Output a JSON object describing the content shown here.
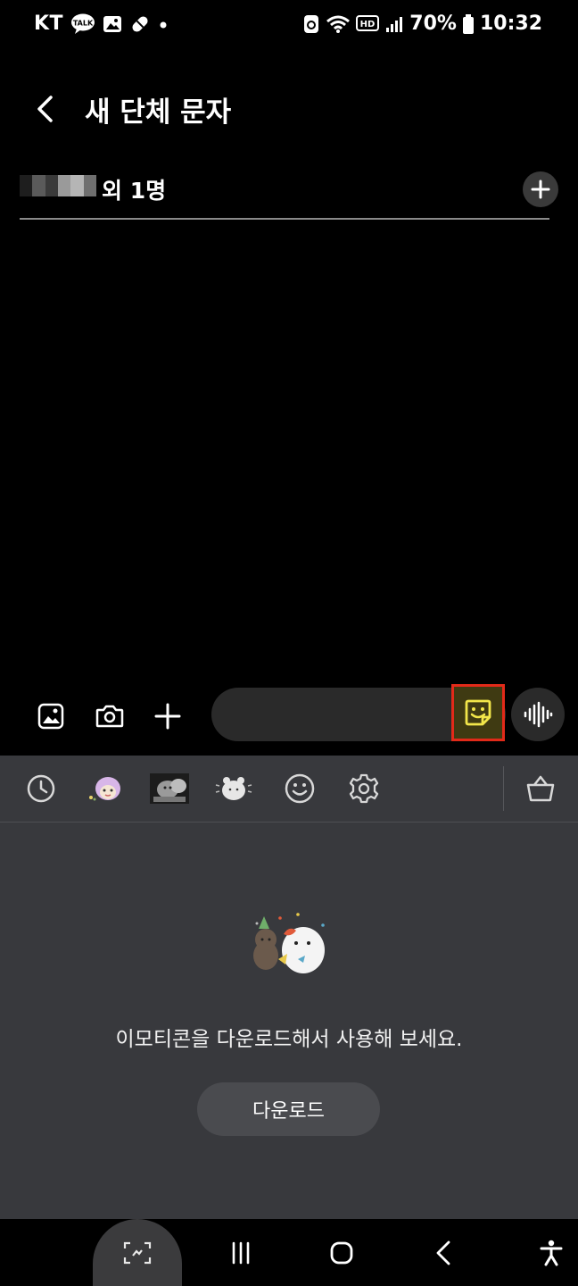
{
  "status_bar": {
    "carrier": "KT",
    "talk_badge": "TALK",
    "network_badge": "HD",
    "battery": "70%",
    "time": "10:32",
    "icons": [
      "kakaotalk-icon",
      "gallery-icon",
      "pill-icon",
      "dot-icon",
      "recycle-icon",
      "wifi-icon",
      "hd-icon",
      "signal-icon",
      "battery-icon"
    ]
  },
  "header": {
    "title": "새 단체 문자",
    "back_icon": "back-arrow-icon"
  },
  "recipients": {
    "suffix": "외 1명",
    "add_icon": "plus-icon"
  },
  "compose": {
    "attach_gallery_icon": "image-icon",
    "camera_icon": "camera-icon",
    "more_icon": "plus-icon",
    "input_value": "",
    "emoji_icon": "sticker-icon",
    "voice_icon": "voice-wave-icon"
  },
  "emoji_panel": {
    "tabs": [
      "recent-icon",
      "sticker-character-1",
      "sticker-character-2",
      "sticker-character-3",
      "smiley-icon",
      "settings-icon"
    ],
    "store_icon": "basket-icon",
    "empty_message": "이모티콘을 다운로드해서 사용해 보세요.",
    "download_label": "다운로드"
  },
  "nav_bar": {
    "items": [
      "screen-capture-icon",
      "recent-apps-icon",
      "home-icon",
      "back-icon",
      "accessibility-icon"
    ]
  },
  "colors": {
    "background": "#000000",
    "panel": "#38393d",
    "highlight": "#e22a19",
    "accent_yellow": "#f2e64a"
  }
}
